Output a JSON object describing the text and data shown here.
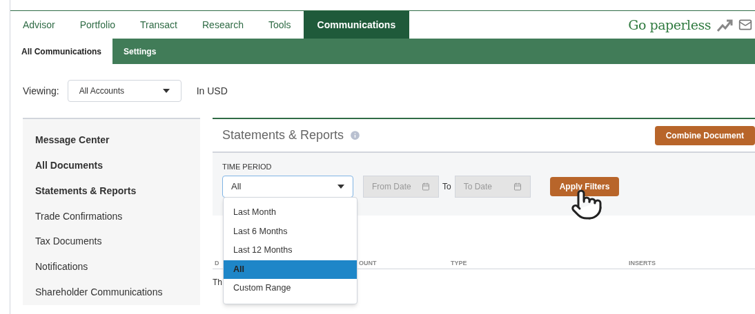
{
  "top_nav": [
    {
      "label": "Advisor",
      "selected": false
    },
    {
      "label": "Portfolio",
      "selected": false
    },
    {
      "label": "Transact",
      "selected": false
    },
    {
      "label": "Research",
      "selected": false
    },
    {
      "label": "Tools",
      "selected": false
    },
    {
      "label": "Communications",
      "selected": true
    }
  ],
  "brand": {
    "text": "Go paperless"
  },
  "sub_nav": [
    {
      "label": "All Communications",
      "selected": true
    },
    {
      "label": "Settings",
      "selected": false
    }
  ],
  "viewing": {
    "label": "Viewing:",
    "value": "All Accounts",
    "currency": "In USD"
  },
  "sidebar": {
    "items": [
      {
        "label": "Message Center",
        "emphasized": true
      },
      {
        "label": "All Documents",
        "emphasized": true
      },
      {
        "label": "Statements & Reports",
        "emphasized": true
      },
      {
        "label": "Trade Confirmations",
        "emphasized": false
      },
      {
        "label": "Tax Documents",
        "emphasized": false
      },
      {
        "label": "Notifications",
        "emphasized": false
      },
      {
        "label": "Shareholder Communications",
        "emphasized": false
      }
    ]
  },
  "panel": {
    "title": "Statements & Reports",
    "combine_button": "Combine Document",
    "filters": {
      "time_period_label": "TIME PERIOD",
      "time_period_value": "All",
      "from_placeholder": "From Date",
      "to_label": "To",
      "to_placeholder": "To Date",
      "apply_button": "Apply Filters"
    },
    "dropdown": {
      "options": [
        {
          "label": "Last Month",
          "selected": false
        },
        {
          "label": "Last 6 Months",
          "selected": false
        },
        {
          "label": "Last 12 Months",
          "selected": false
        },
        {
          "label": "All",
          "selected": true
        },
        {
          "label": "Custom Range",
          "selected": false
        }
      ]
    },
    "table": {
      "columns": [
        "D",
        "OUNT",
        "TYPE",
        "INSERTS"
      ],
      "message": "Th"
    }
  }
}
